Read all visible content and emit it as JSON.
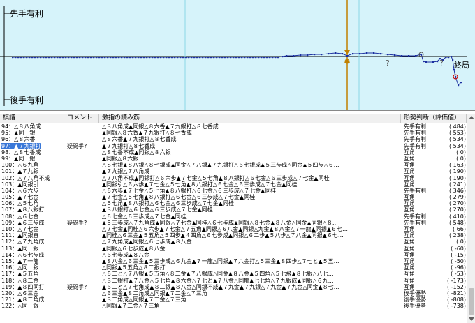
{
  "graph": {
    "top_label": "先手有利",
    "bottom_label": "後手有利",
    "end_label": "終局",
    "question_mark": "?",
    "colors": {
      "background": "#d6f3fa",
      "line": "#1b2fa0",
      "marker": "#c08000",
      "grid": "#8ad7e6"
    }
  },
  "list": {
    "headers": [
      "棋譜",
      "コメント",
      "激指の読み筋",
      "形勢判断（評価値）"
    ],
    "rows": [
      {
        "move": "94：△８八角成",
        "comment": "",
        "line": "△８八角成▲同銀△８六香▲７九銀打△８七香成",
        "eval": "先手有利",
        "score": "( 484)"
      },
      {
        "move": "95：▲同　銀",
        "comment": "",
        "line": "▲同銀△８六香▲７九銀打△８七香成",
        "eval": "先手有利",
        "score": "( 553)"
      },
      {
        "move": "96：△８六香",
        "comment": "",
        "line": "△８六香▲７九銀打△８七香成",
        "eval": "先手有利",
        "score": "( 534)"
      },
      {
        "move": "97：▲７九銀打",
        "comment": "疑問手?",
        "line": "▲７九銀打△８七香成",
        "eval": "先手有利",
        "score": "( 534)",
        "selected": true
      },
      {
        "move": "98：△８七香成",
        "comment": "",
        "line": "△８七香不成▲同銀△８六銀",
        "eval": "互角",
        "score": "( 0)"
      },
      {
        "move": "99：▲同　銀",
        "comment": "",
        "line": "▲同銀△８六銀",
        "eval": "互角",
        "score": "( 0)"
      },
      {
        "move": "100：△６九角",
        "comment": "",
        "line": "△８七銀▲８八銀△８七銀成▲同金△７八銀▲７九銀打△６七銀成▲５三歩成△同金▲５四歩△６…",
        "eval": "互角",
        "score": "( 163)"
      },
      {
        "move": "101：▲７九銀",
        "comment": "",
        "line": "▲７九銀△７八角成",
        "eval": "互角",
        "score": "( 190)"
      },
      {
        "move": "102：△７八角不成",
        "comment": "",
        "line": "△７八角不成▲同銀打△６六歩▲７七金△５七角▲８八銀打△６七金△６三歩成△７七金▲同桂",
        "eval": "互角",
        "score": "( 190)"
      },
      {
        "move": "103：▲同銀引",
        "comment": "",
        "line": "▲同銀引△６六歩▲７七金△５七角▲８八銀打△６七金△６三歩成△７七金▲同桂",
        "eval": "互角",
        "score": "( 241)"
      },
      {
        "move": "104：△６六歩",
        "comment": "",
        "line": "△６六歩▲７七金△５七角▲８八銀打△６七金△６三歩成△７七金▲同桂",
        "eval": "先手有利",
        "score": "( 346)"
      },
      {
        "move": "105：▲７七金",
        "comment": "",
        "line": "▲７七金△５七角▲８八銀打△６七金△６三歩成△７七金▲同桂",
        "eval": "互角",
        "score": "( 279)"
      },
      {
        "move": "106：△５七角",
        "comment": "",
        "line": "△５七角▲８八銀打△６七金△６三歩成△７七金▲同桂",
        "eval": "互角",
        "score": "( 270)"
      },
      {
        "move": "107：▲８八銀打",
        "comment": "",
        "line": "▲８八銀打△６七金△６三歩成△７七金▲同桂",
        "eval": "互角",
        "score": "( 270)"
      },
      {
        "move": "108：△６七金",
        "comment": "",
        "line": "△６七金△６三歩成△７七金▲同桂",
        "eval": "先手有利",
        "score": "( 410)"
      },
      {
        "move": "109：▲６三歩成",
        "comment": "疑問手?",
        "line": "▲５三歩成△７九角成▲同銀△７七金▲同桂△６七歩成▲同銀△８七金▲８八金△同金▲同銀△８…",
        "eval": "先手有利",
        "score": "( 548)"
      },
      {
        "move": "110：△７七金",
        "comment": "",
        "line": "△７七金▲同桂△６六歩▲７七金△７五角▲同銀△６八金▲同銀△九金▲８八金△７一龍▲同銀▲６七…",
        "eval": "互角",
        "score": "( 66)"
      },
      {
        "move": "111：▲同銀直",
        "comment": "",
        "line": "▲同桂△６三金▲５五角△５四歩▲４四角△６七歩成▲同銀△６二歩▲５八歩△７八金▲同銀▲６七…",
        "eval": "互角",
        "score": "( 238)"
      },
      {
        "move": "112：△７九角成",
        "comment": "",
        "line": "△７九角成▲同銀△６七歩成▲８八金",
        "eval": "互角",
        "score": "( 0)"
      },
      {
        "move": "113：▲同　銀",
        "comment": "",
        "line": "▲同銀△６七歩成▲８八金",
        "eval": "互角",
        "score": "( -60)"
      },
      {
        "move": "114：△６七歩成",
        "comment": "",
        "line": "△６七歩成▲８八金",
        "eval": "互角",
        "score": "( -15)"
      },
      {
        "move": "115：▲７一龍",
        "comment": "",
        "line": "▲８八金△６三金▲５三歩成△６九金▲７一龍△同銀▲７八金打△５三金▲８四歩△７七と▲５五…",
        "eval": "互角",
        "score": "( -50)"
      },
      {
        "move": "116：△同　銀",
        "comment": "",
        "line": "△同銀▲５五角△８二銀打",
        "eval": "互角",
        "score": "( -96)"
      },
      {
        "move": "117：▲５五角",
        "comment": "",
        "line": "△６二と△７八銀▲５五角△８二金▲７八銀成△同金▲８八金▲５四角△５七飛▲８七銀△八七…",
        "eval": "互角",
        "score": "( -53)"
      },
      {
        "move": "118：△８二金",
        "comment": "",
        "line": "△８二銀打▲７八金△５七角▲８六金△７七と▲７八金△同龍▲七七角△７九銀成▲同銀△６九…",
        "eval": "互角",
        "score": "( -173)"
      },
      {
        "move": "119：▲８四同打",
        "comment": "疑問手?",
        "line": "▲６二と△７七角成▲８二銀▲８八金△同銀不成▲７九金▲７九銀△７九金▲７九金△同金▲８七…",
        "eval": "互角",
        "score": "( -152)"
      },
      {
        "move": "120：△６三金",
        "comment": "",
        "line": "△６三金▲８二角成△同銀▲７二金△７三角",
        "eval": "後手優勢",
        "score": "( -821)"
      },
      {
        "move": "121：▲８二角成",
        "comment": "",
        "line": "▲８二角成△同銀▲７二金△７三角",
        "eval": "後手優勢",
        "score": "( -808)"
      },
      {
        "move": "122：△同　銀",
        "comment": "",
        "line": "△同銀▲７二金△７三角",
        "eval": "後手優勢",
        "score": "( -738)"
      }
    ]
  }
}
